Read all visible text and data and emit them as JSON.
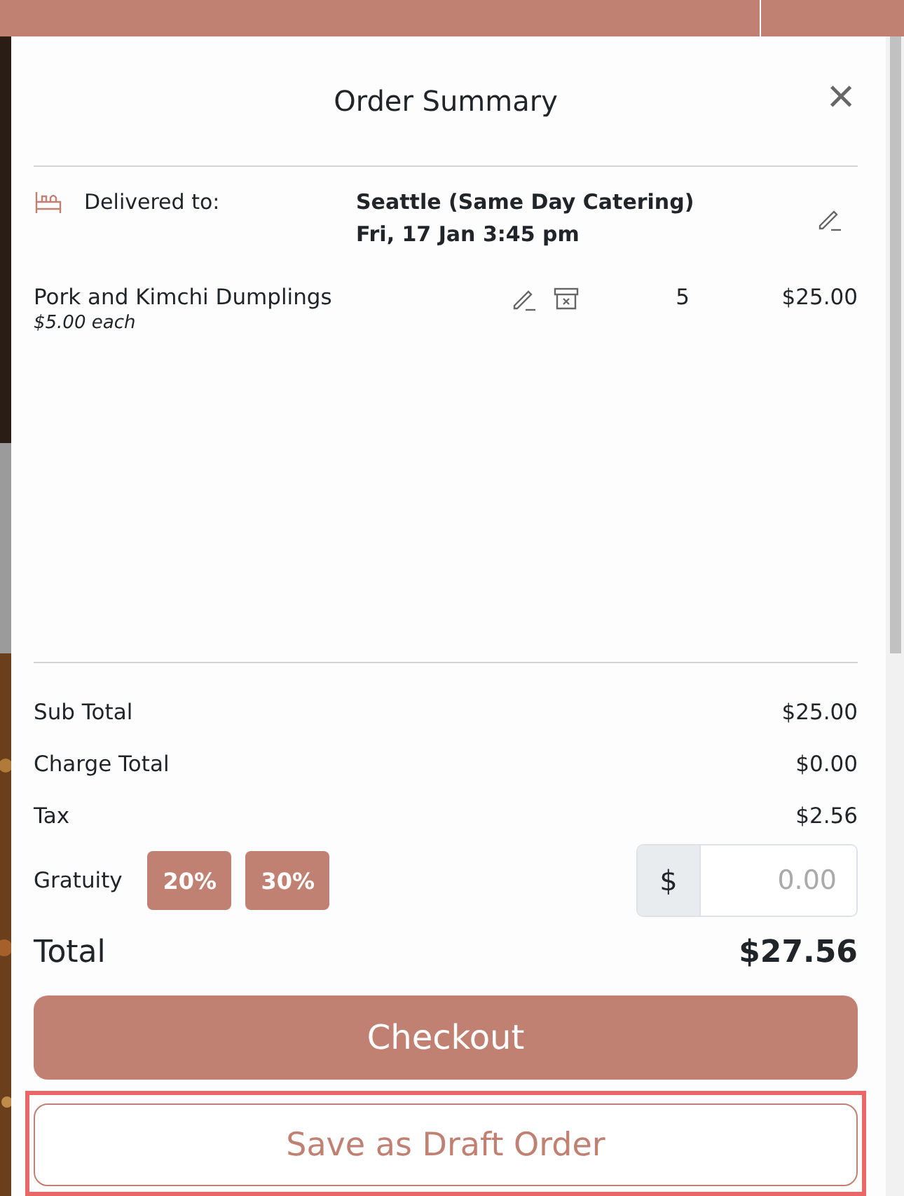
{
  "modal": {
    "title": "Order Summary",
    "close": "×"
  },
  "delivery": {
    "label": "Delivered to:",
    "location": "Seattle (Same Day Catering)",
    "time": "Fri, 17 Jan 3:45 pm"
  },
  "items": [
    {
      "name": "Pork and Kimchi Dumplings",
      "unit_price": "$5.00 each",
      "quantity": "5",
      "price": "$25.00"
    }
  ],
  "summary": [
    {
      "label": "Sub Total",
      "value": "$25.00"
    },
    {
      "label": "Charge Total",
      "value": "$0.00"
    },
    {
      "label": "Tax",
      "value": "$2.56"
    }
  ],
  "gratuity": {
    "label": "Gratuity",
    "options": [
      {
        "label": "20%",
        "selected": false
      },
      {
        "label": "30%",
        "selected": false
      }
    ],
    "currency": "$",
    "placeholder": "0.00"
  },
  "total": {
    "label": "Total",
    "value": "$27.56"
  },
  "checkout": "Checkout",
  "draft": {
    "label": "Save as Draft Order",
    "highlighted": true
  }
}
